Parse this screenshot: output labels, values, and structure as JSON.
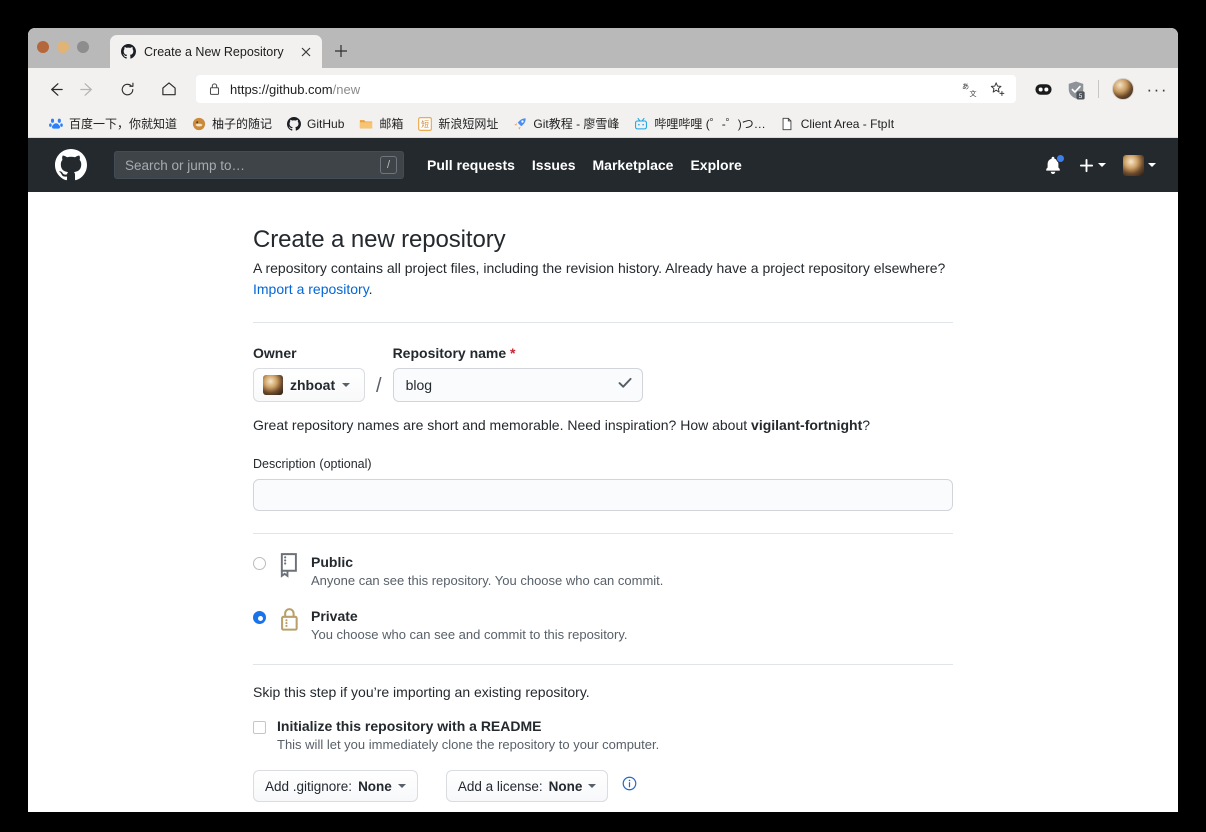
{
  "window": {
    "controls": [
      "close",
      "minimize",
      "maximize"
    ]
  },
  "browser": {
    "tab": {
      "title": "Create a New Repository",
      "favicon": "github-icon",
      "close_label": "×"
    },
    "new_tab_label": "+",
    "nav": {
      "back": "back-arrow-icon",
      "forward": "forward-arrow-icon",
      "reload": "reload-icon",
      "home": "home-icon"
    },
    "omnibox": {
      "url_secure": "https://github.com",
      "url_path": "/new",
      "full_url": "https://github.com/new",
      "lock": "lock-icon",
      "translate": "translate-icon",
      "bookmark": "star-plus-icon"
    },
    "extensions": [
      {
        "name": "extension-1",
        "badge": ""
      },
      {
        "name": "extension-2",
        "badge": "5"
      }
    ],
    "menu_dots": "···"
  },
  "bookmarks": [
    {
      "label": "百度一下，你就知道",
      "icon": "baidu-icon"
    },
    {
      "label": "柚子的随记",
      "icon": "pomelo-icon"
    },
    {
      "label": "GitHub",
      "icon": "github-icon"
    },
    {
      "label": "邮箱",
      "icon": "folder-icon"
    },
    {
      "label": "新浪短网址",
      "icon": "sina-short-icon"
    },
    {
      "label": "Git教程 - 廖雪峰",
      "icon": "rocket-icon"
    },
    {
      "label": "哔哩哔哩 (゜-゜)つ…",
      "icon": "bilibili-icon"
    },
    {
      "label": "Client Area - FtpIt",
      "icon": "page-icon"
    }
  ],
  "github": {
    "header": {
      "logo": "github-mark-icon",
      "search_placeholder": "Search or jump to…",
      "search_shortcut": "/",
      "nav": [
        "Pull requests",
        "Issues",
        "Marketplace",
        "Explore"
      ],
      "notifications": "bell-icon",
      "create_new": "plus-icon",
      "avatar": "user-avatar"
    },
    "page": {
      "title": "Create a new repository",
      "subtitle_part1": "A repository contains all project files, including the revision history. Already have a project repository elsewhere? ",
      "subtitle_link": "Import a repository",
      "subtitle_end": ".",
      "owner_label": "Owner",
      "owner_value": "zhboat",
      "slash": "/",
      "repo_label": "Repository name",
      "repo_required": "*",
      "repo_value": "blog",
      "repo_valid_icon": "check-icon",
      "name_hint_prefix": "Great repository names are short and memorable. Need inspiration? How about ",
      "name_hint_suggestion": "vigilant-fortnight",
      "name_hint_suffix": "?",
      "description_label": "Description",
      "description_optional": "(optional)",
      "description_value": "",
      "visibility": [
        {
          "id": "public",
          "title": "Public",
          "description": "Anyone can see this repository. You choose who can commit.",
          "icon": "repo-book-icon",
          "selected": false
        },
        {
          "id": "private",
          "title": "Private",
          "description": "You choose who can see and commit to this repository.",
          "icon": "lock-icon",
          "selected": true
        }
      ],
      "skip_text": "Skip this step if you’re importing an existing repository.",
      "readme_title": "Initialize this repository with a README",
      "readme_sub": "This will let you immediately clone the repository to your computer.",
      "readme_checked": false,
      "gitignore_prefix": "Add .gitignore: ",
      "gitignore_value": "None",
      "license_prefix": "Add a license: ",
      "license_value": "None",
      "info_icon": "info-icon"
    }
  },
  "colors": {
    "gh_header_bg": "#24292e",
    "link_blue": "#0366d6",
    "required_red": "#cb2431",
    "radio_selected": "#1a73e8",
    "lock_gold": "#b9a06a"
  }
}
